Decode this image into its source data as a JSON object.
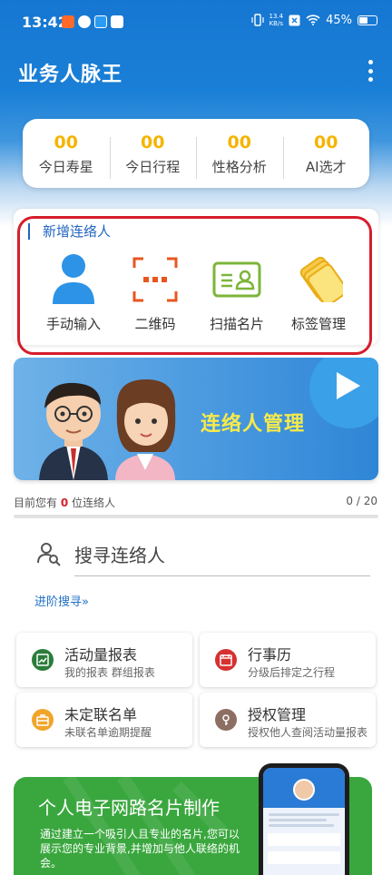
{
  "status_bar": {
    "time": "13:42",
    "net_speed_value": "13.4",
    "net_speed_unit": "KB/s",
    "battery": "45%"
  },
  "header": {
    "title": "业务人脉王"
  },
  "stats": [
    {
      "value": "00",
      "label": "今日寿星"
    },
    {
      "value": "00",
      "label": "今日行程"
    },
    {
      "value": "00",
      "label": "性格分析"
    },
    {
      "value": "00",
      "label": "AI选才"
    }
  ],
  "new_contact": {
    "heading": "新增连络人",
    "actions": [
      {
        "label": "手动输入",
        "icon": "person-icon"
      },
      {
        "label": "二维码",
        "icon": "qr-scan-icon"
      },
      {
        "label": "扫描名片",
        "icon": "id-card-icon"
      },
      {
        "label": "标签管理",
        "icon": "tags-icon"
      }
    ]
  },
  "banner": {
    "title": "连络人管理"
  },
  "contact_count": {
    "prefix": "目前您有",
    "count": "0",
    "suffix": "位连络人",
    "ratio": "0 / 20",
    "progress": 0
  },
  "search": {
    "placeholder": "搜寻连络人",
    "advanced": "进阶搜寻»"
  },
  "features": [
    {
      "title": "活动量报表",
      "subtitle": "我的报表 群组报表",
      "icon": "report-icon",
      "color": "#2a7d3a"
    },
    {
      "title": "行事历",
      "subtitle": "分级后排定之行程",
      "icon": "calendar-icon",
      "color": "#d63131"
    },
    {
      "title": "未定联名单",
      "subtitle": "未联名单逾期提醒",
      "icon": "briefcase-icon",
      "color": "#f0a52a"
    },
    {
      "title": "授权管理",
      "subtitle": "授权他人查阅活动量报表",
      "icon": "key-icon",
      "color": "#8d6e63"
    }
  ],
  "promo": {
    "title": "个人电子网路名片制作",
    "description": "通过建立一个吸引人且专业的名片,您可以展示您的专业背景,并增加与他人联络的机会。"
  },
  "colors": {
    "brand_blue": "#1a7fd6",
    "stat_yellow": "#f5b400",
    "highlight_red": "#d61d2b",
    "promo_green": "#3aa73e"
  }
}
